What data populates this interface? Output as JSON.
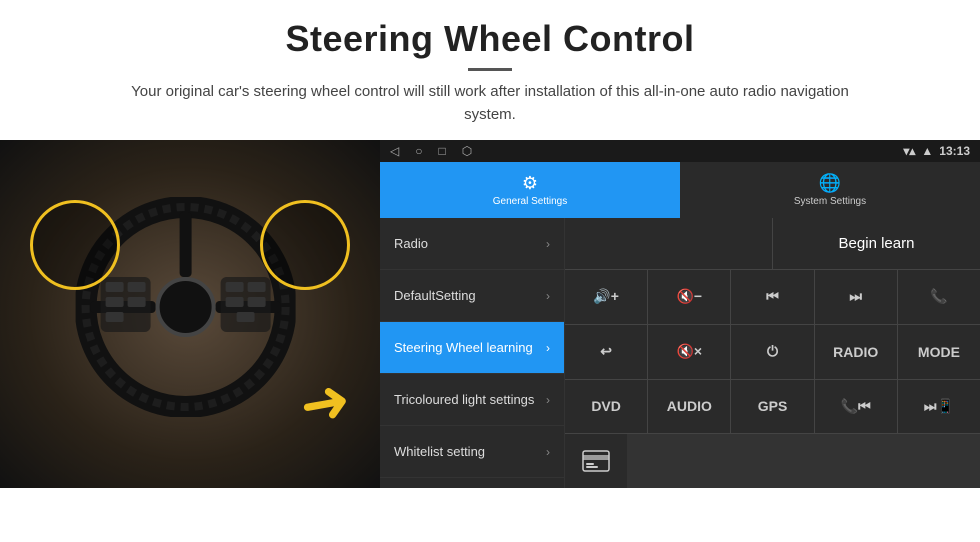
{
  "header": {
    "title": "Steering Wheel Control",
    "divider": true,
    "subtitle": "Your original car's steering wheel control will still work after installation of this all-in-one auto radio navigation system."
  },
  "status_bar": {
    "nav_back": "◁",
    "nav_home": "○",
    "nav_recent": "□",
    "nav_cast": "⬡",
    "signal": "▾▴",
    "wifi": "▲",
    "time": "13:13"
  },
  "tabs": [
    {
      "id": "general",
      "label": "General Settings",
      "active": true
    },
    {
      "id": "system",
      "label": "System Settings",
      "active": false
    }
  ],
  "menu_items": [
    {
      "id": "radio",
      "label": "Radio",
      "active": false
    },
    {
      "id": "default",
      "label": "DefaultSetting",
      "active": false
    },
    {
      "id": "steering",
      "label": "Steering Wheel learning",
      "active": true
    },
    {
      "id": "tricoloured",
      "label": "Tricoloured light settings",
      "active": false
    },
    {
      "id": "whitelist",
      "label": "Whitelist setting",
      "active": false
    }
  ],
  "begin_learn_label": "Begin learn",
  "control_buttons": {
    "row1": [
      {
        "id": "vol-up",
        "label": "🔊+",
        "type": "icon"
      },
      {
        "id": "vol-down",
        "label": "🔇-",
        "type": "icon"
      },
      {
        "id": "prev-track",
        "label": "⏮",
        "type": "icon"
      },
      {
        "id": "next-track",
        "label": "⏭",
        "type": "icon"
      },
      {
        "id": "phone",
        "label": "📞",
        "type": "icon"
      }
    ],
    "row2": [
      {
        "id": "hang-up",
        "label": "↩",
        "type": "icon"
      },
      {
        "id": "mute",
        "label": "🔇×",
        "type": "icon"
      },
      {
        "id": "power",
        "label": "⏻",
        "type": "icon"
      },
      {
        "id": "radio-btn",
        "label": "RADIO",
        "type": "text"
      },
      {
        "id": "mode-btn",
        "label": "MODE",
        "type": "text"
      }
    ],
    "row3": [
      {
        "id": "dvd-btn",
        "label": "DVD",
        "type": "text"
      },
      {
        "id": "audio-btn",
        "label": "AUDIO",
        "type": "text"
      },
      {
        "id": "gps-btn",
        "label": "GPS",
        "type": "text"
      },
      {
        "id": "prev-mixed",
        "label": "📞⏮",
        "type": "icon"
      },
      {
        "id": "next-mixed",
        "label": "⏭📱",
        "type": "icon"
      }
    ],
    "row4_single": {
      "id": "card-icon",
      "label": "≡",
      "type": "icon"
    }
  }
}
